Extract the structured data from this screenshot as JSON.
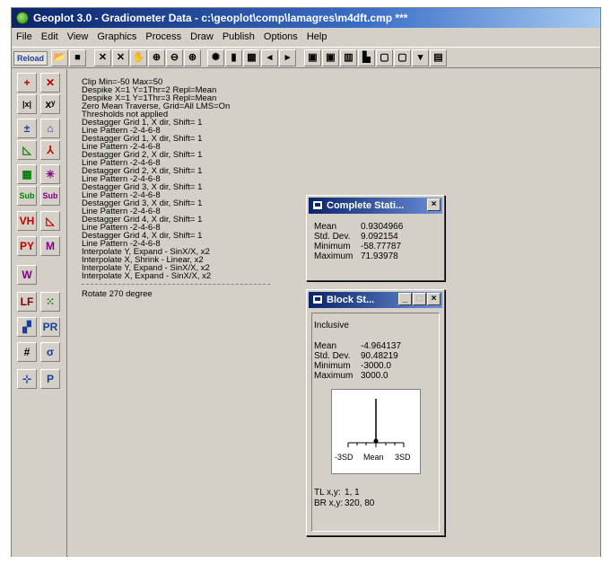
{
  "window": {
    "title": "Geoplot 3.0 - Gradiometer Data  -  c:\\geoplot\\comp\\lamagres\\m4dft.cmp ***"
  },
  "menu": [
    "File",
    "Edit",
    "View",
    "Graphics",
    "Process",
    "Draw",
    "Publish",
    "Options",
    "Help"
  ],
  "toolbar": {
    "reload_label": "Reload",
    "buttons": [
      {
        "icon": "open-folder-icon",
        "glyph": "📂"
      },
      {
        "icon": "save-disk-icon",
        "glyph": "■"
      },
      {
        "icon": "crosshair-icon",
        "glyph": "✕"
      },
      {
        "icon": "cross-arrows-icon",
        "glyph": "✕"
      },
      {
        "icon": "hand-icon",
        "glyph": "✋"
      },
      {
        "icon": "zoom-in-icon",
        "glyph": "⊕"
      },
      {
        "icon": "zoom-out-icon",
        "glyph": "⊖"
      },
      {
        "icon": "zoom-fit-icon",
        "glyph": "⊛"
      },
      {
        "icon": "palette-icon",
        "glyph": "✺"
      },
      {
        "icon": "grid-bars-icon",
        "glyph": "▮"
      },
      {
        "icon": "mesh-icon",
        "glyph": "▦"
      },
      {
        "icon": "shift-left-icon",
        "glyph": "◂"
      },
      {
        "icon": "shift-right-icon",
        "glyph": "▸"
      },
      {
        "icon": "grid-view-1-icon",
        "glyph": "▣"
      },
      {
        "icon": "grid-view-2-icon",
        "glyph": "▣"
      },
      {
        "icon": "grid-view-3-icon",
        "glyph": "▥"
      },
      {
        "icon": "histogram-icon",
        "glyph": "▙"
      },
      {
        "icon": "window-1-icon",
        "glyph": "▢"
      },
      {
        "icon": "window-2-icon",
        "glyph": "▢"
      },
      {
        "icon": "dropdown-icon",
        "glyph": "▾"
      },
      {
        "icon": "report-icon",
        "glyph": "▤"
      }
    ]
  },
  "left_tools": [
    {
      "icon": "add-icon",
      "glyph": "+",
      "color": "#c00000"
    },
    {
      "icon": "clip-icon",
      "glyph": "✕",
      "color": "#c00000"
    },
    {
      "icon": "despike-icon",
      "glyph": "|x|",
      "color": "#000000"
    },
    {
      "icon": "power-icon",
      "glyph": "xʸ",
      "color": "#000000"
    },
    {
      "icon": "zero-mean-icon",
      "glyph": "±",
      "color": "#1a3f9b"
    },
    {
      "icon": "traverse-icon",
      "glyph": "⌂",
      "color": "#1a3f9b"
    },
    {
      "icon": "edge-icon",
      "glyph": "◺",
      "color": "#008000"
    },
    {
      "icon": "peak-icon",
      "glyph": "⅄",
      "color": "#c00000"
    },
    {
      "icon": "interpolate-icon",
      "glyph": "▦",
      "color": "#008000"
    },
    {
      "icon": "spike-icon",
      "glyph": "✳",
      "color": "#800080"
    },
    {
      "icon": "sub-1-icon",
      "glyph": "Sub",
      "color": "#008000"
    },
    {
      "icon": "sub-2-icon",
      "glyph": "Sub",
      "color": "#800080"
    },
    {
      "icon": "high-pass-icon",
      "glyph": "VH",
      "color": "#c00000"
    },
    {
      "icon": "low-pass-icon",
      "glyph": "◺",
      "color": "#c00000"
    },
    {
      "icon": "periodic-y-icon",
      "glyph": "PY",
      "color": "#c00000"
    },
    {
      "icon": "periodic-m-icon",
      "glyph": "M",
      "color": "#800080"
    },
    {
      "icon": "wallis-icon",
      "glyph": "W",
      "color": "#800080"
    },
    {
      "icon": "log-icon",
      "glyph": "LF",
      "color": "#800000"
    },
    {
      "icon": "grid-dots-icon",
      "glyph": "⁙",
      "color": "#008000"
    },
    {
      "icon": "stagger-icon",
      "glyph": "▞",
      "color": "#1a3f9b"
    },
    {
      "icon": "pseudo-icon",
      "glyph": "PR",
      "color": "#1a3f9b"
    },
    {
      "icon": "hash-icon",
      "glyph": "#",
      "color": "#000000"
    },
    {
      "icon": "sigma-icon",
      "glyph": "σ",
      "color": "#1a3f9b"
    },
    {
      "icon": "compass-icon",
      "glyph": "⊹",
      "color": "#1a3f9b"
    },
    {
      "icon": "print-icon",
      "glyph": "P",
      "color": "#1a3f9b"
    }
  ],
  "history": [
    "Clip Min=-50 Max=50",
    "Despike X=1 Y=1Thr=2 Repl=Mean",
    "Despike X=1 Y=1Thr=3 Repl=Mean",
    "Zero Mean Traverse, Grid=All LMS=On",
    "Thresholds not applied",
    "Destagger Grid 1, X dir, Shift= 1",
    "Line Pattern -2-4-6-8",
    "Destagger Grid 1, X dir, Shift= 1",
    "Line Pattern -2-4-6-8",
    "Destagger Grid 2, X dir, Shift= 1",
    "Line Pattern -2-4-6-8",
    "Destagger Grid 2, X dir, Shift= 1",
    "Line Pattern -2-4-6-8",
    "Destagger Grid 3, X dir, Shift= 1",
    "Line Pattern -2-4-6-8",
    "Destagger Grid 3, X dir, Shift= 1",
    "Line Pattern -2-4-6-8",
    "Destagger Grid 4, X dir, Shift= 1",
    "Line Pattern -2-4-6-8",
    "Destagger Grid 4, X dir, Shift= 1",
    "Line Pattern -2-4-6-8",
    "Interpolate Y, Expand - SinX/X, x2",
    "Interpolate X, Shrink - Linear, x2",
    "Interpolate Y, Expand - SinX/X, x2",
    "Interpolate X, Expand - SinX/X, x2"
  ],
  "history_last": "Rotate 270 degree",
  "complete_stats": {
    "title": "Complete Stati...",
    "close_label": "×",
    "rows": [
      {
        "label": "Mean",
        "value": "0.9304966"
      },
      {
        "label": "Std. Dev.",
        "value": "9.092154"
      },
      {
        "label": "Minimum",
        "value": "-58.77787"
      },
      {
        "label": "Maximum",
        "value": "71.93978"
      }
    ]
  },
  "block_stats": {
    "title": "Block  St...",
    "min_label": "_",
    "max_label": "□",
    "close_label": "×",
    "group_label": "Inclusive",
    "rows": [
      {
        "label": "Mean",
        "value": "-4.964137"
      },
      {
        "label": "Std. Dev.",
        "value": "90.48219"
      },
      {
        "label": "Minimum",
        "value": "-3000.0"
      },
      {
        "label": "Maximum",
        "value": "3000.0"
      }
    ],
    "axis_labels": [
      "-3SD",
      "Mean",
      "3SD"
    ],
    "tl_label": "TL x,y:",
    "tl_value": "1, 1",
    "br_label": "BR x,y:",
    "br_value": "320, 80"
  }
}
